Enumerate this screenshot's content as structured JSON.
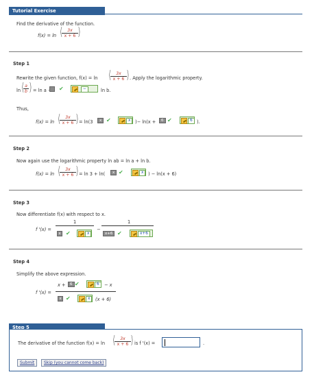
{
  "header": {
    "title": "Tutorial Exercise"
  },
  "problem": {
    "instruction": "Find the derivative of the function.",
    "fx": "f(x) = ln",
    "num": "3x",
    "den": "x + 6"
  },
  "step1": {
    "label": "Step 1",
    "rewrite": "Rewrite the given function, f(x) = ln",
    "num": "3x",
    "den": "x + 6",
    "after": ". Apply the logarithmic property.",
    "prop_ln": "ln",
    "prop_a": "a",
    "prop_b": "b",
    "prop_eq": "= ln a −",
    "prop_minus": "−",
    "prop_lnb": "ln b.",
    "thus": "Thus,",
    "eq_left": "f(x) = ln",
    "eq_mid": "= ln(3",
    "ans_x": "x",
    "eq_minus": ")− ln(x +",
    "ans_6": "6",
    "eq_end": ")."
  },
  "step2": {
    "label": "Step 2",
    "text": "Now again use the logarithmic property ln ab = ln a + ln b.",
    "eq_left": "f(x) = ln",
    "num": "3x",
    "den": "x + 6",
    "eq_mid": "= ln 3 + ln(",
    "ans_x": "x",
    "eq_end": ") − ln(x + 6)"
  },
  "step3": {
    "label": "Step 3",
    "text": "Now differentiate f(x) with respect to x.",
    "fprime": "f '(x) =",
    "one1": "1",
    "one2": "1",
    "ans_x": "x",
    "minus": "−",
    "gray_x6": "x+6",
    "ans_x6": "x+6"
  },
  "step4": {
    "label": "Step 4",
    "text": "Simplify the above expression.",
    "fprime": "f '(x) =",
    "num_a": "x +",
    "ans_6": "6",
    "num_b": "− x",
    "ans_x": "x",
    "den_b": "(x + 6)"
  },
  "step5": {
    "label": "Step 5",
    "text": "The derivative of the function f(x) = ln",
    "num": "3x",
    "den": "x + 6",
    "is": "is f '(x) =",
    "period": "."
  },
  "buttons": {
    "submit": "Submit",
    "skip": "Skip (you cannot come back)"
  }
}
